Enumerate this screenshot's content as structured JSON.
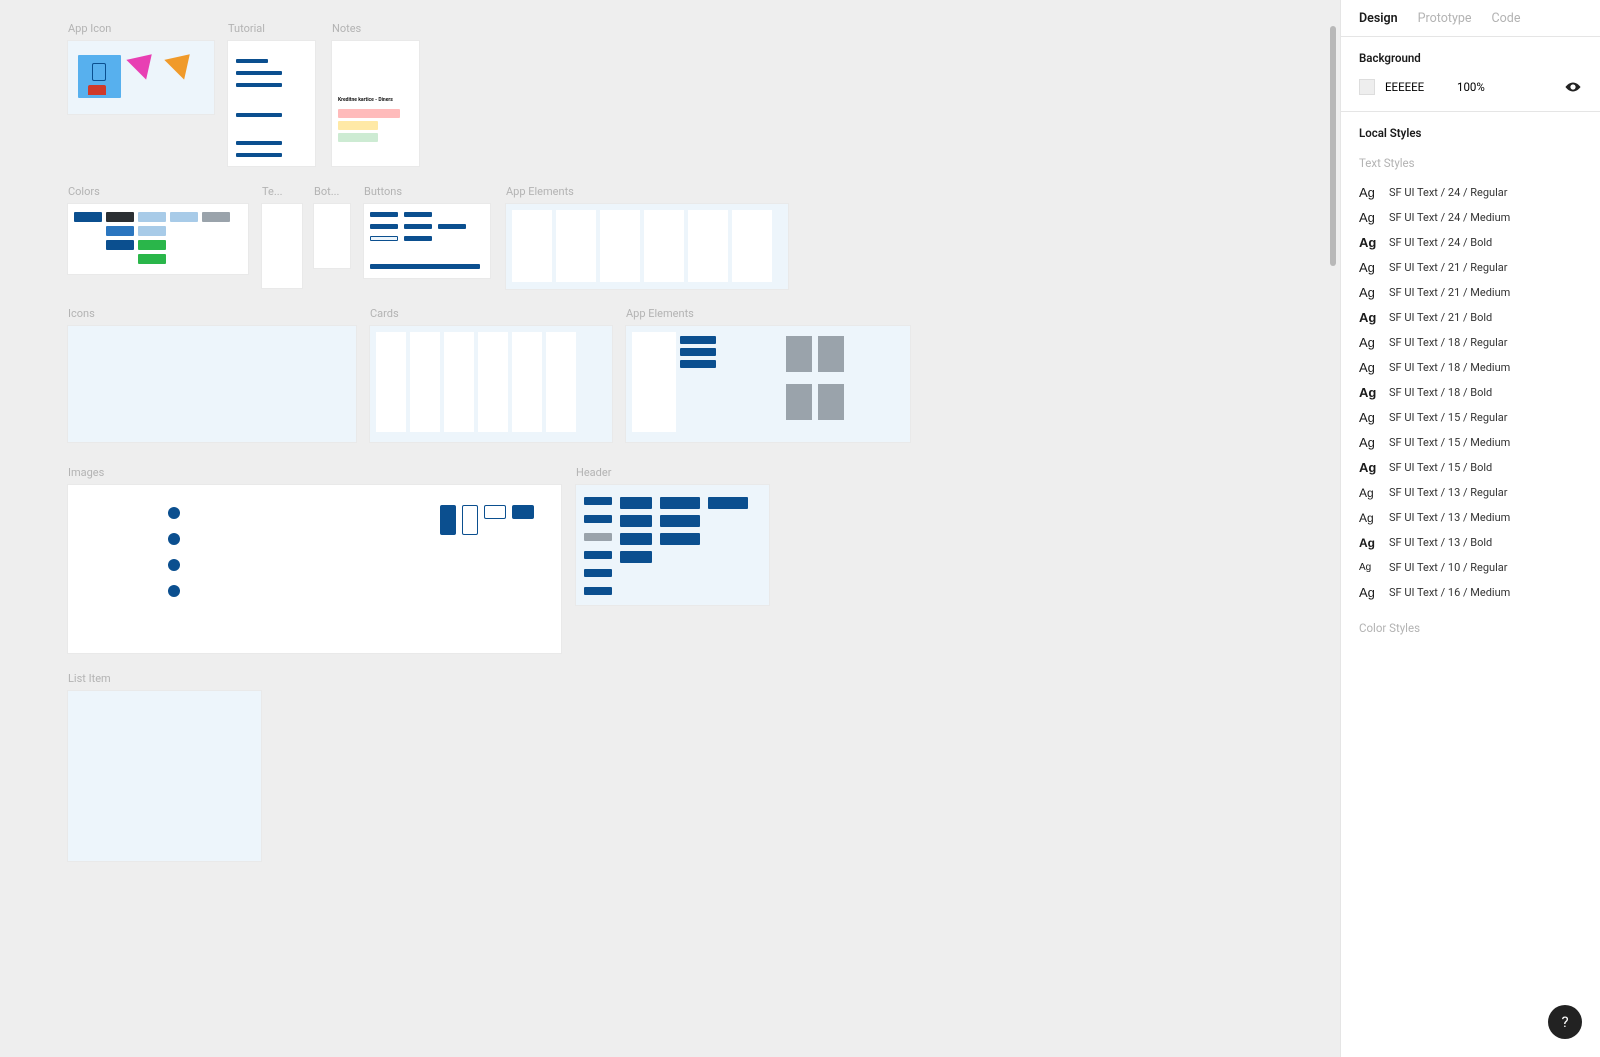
{
  "tabs": {
    "design": "Design",
    "prototype": "Prototype",
    "code": "Code"
  },
  "background": {
    "title": "Background",
    "hex": "EEEEEE",
    "opacity": "100%"
  },
  "local_styles": {
    "title": "Local Styles",
    "text_styles_title": "Text Styles",
    "color_styles_title": "Color Styles",
    "text_styles": [
      {
        "ag_size": 13,
        "ag_weight": 400,
        "label": "SF UI Text / 24 / Regular"
      },
      {
        "ag_size": 13,
        "ag_weight": 500,
        "label": "SF UI Text / 24 / Medium"
      },
      {
        "ag_size": 13,
        "ag_weight": 700,
        "label": "SF UI Text / 24 / Bold"
      },
      {
        "ag_size": 13,
        "ag_weight": 400,
        "label": "SF UI Text / 21 / Regular"
      },
      {
        "ag_size": 13,
        "ag_weight": 500,
        "label": "SF UI Text / 21 / Medium"
      },
      {
        "ag_size": 13,
        "ag_weight": 700,
        "label": "SF UI Text / 21 / Bold"
      },
      {
        "ag_size": 13,
        "ag_weight": 400,
        "label": "SF UI Text / 18 / Regular"
      },
      {
        "ag_size": 13,
        "ag_weight": 500,
        "label": "SF UI Text / 18 / Medium"
      },
      {
        "ag_size": 13,
        "ag_weight": 700,
        "label": "SF UI Text / 18 / Bold"
      },
      {
        "ag_size": 13,
        "ag_weight": 400,
        "label": "SF UI Text / 15 / Regular"
      },
      {
        "ag_size": 13,
        "ag_weight": 500,
        "label": "SF UI Text / 15 / Medium"
      },
      {
        "ag_size": 13,
        "ag_weight": 700,
        "label": "SF UI Text / 15 / Bold"
      },
      {
        "ag_size": 12,
        "ag_weight": 400,
        "label": "SF UI Text / 13 / Regular"
      },
      {
        "ag_size": 12,
        "ag_weight": 500,
        "label": "SF UI Text / 13 / Medium"
      },
      {
        "ag_size": 12,
        "ag_weight": 700,
        "label": "SF UI Text / 13 / Bold"
      },
      {
        "ag_size": 10,
        "ag_weight": 400,
        "label": "SF UI Text / 10 / Regular"
      },
      {
        "ag_size": 13,
        "ag_weight": 500,
        "label": "SF UI Text / 16 / Medium"
      }
    ]
  },
  "help": "?",
  "canvas": {
    "frames": {
      "app_icon": "App Icon",
      "tutorial": "Tutorial",
      "notes": "Notes",
      "notes_caption": "Kreditne kartice - Diners",
      "colors": "Colors",
      "te": "Te...",
      "bot": "Bot...",
      "buttons": "Buttons",
      "app_elements": "App Elements",
      "icons": "Icons",
      "cards": "Cards",
      "app_elements2": "App Elements",
      "images": "Images",
      "header": "Header",
      "list_item": "List Item"
    }
  },
  "palette": {
    "brand_blue": "#0b4f8f",
    "blue": "#2b76bf",
    "light_blue": "#a8cbe8",
    "pale_blue": "#edf5fb",
    "green": "#2ab64a",
    "pink": "#e83fb3",
    "orange": "#f09a2a",
    "red": "#cf3a2a",
    "grey": "#9aa3ab",
    "dark": "#2b2f33"
  }
}
